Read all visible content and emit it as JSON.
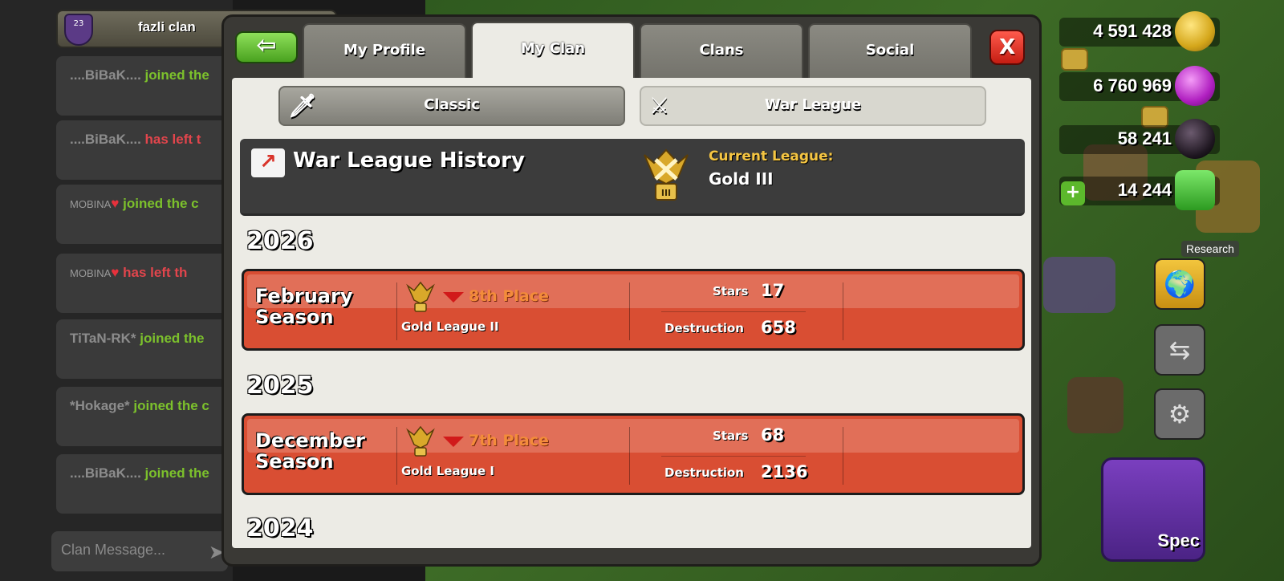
{
  "chat": {
    "clan_name": "fazli clan",
    "clan_level": "23",
    "messages": [
      {
        "user": "....BiBaK....",
        "action": "joined the",
        "type": "join"
      },
      {
        "user": "....BiBaK....",
        "action": "has left t",
        "type": "left"
      },
      {
        "user": "MOBINA",
        "heart": "♥",
        "action": "joined the c",
        "type": "join"
      },
      {
        "user": "MOBINA",
        "heart": "♥",
        "action": "has left th",
        "type": "left"
      },
      {
        "user": "TiTaN-RK*",
        "action": "joined the",
        "type": "join"
      },
      {
        "user": "*Hokage*",
        "action": "joined the c",
        "type": "join"
      },
      {
        "user": "....BiBaK....",
        "action": "joined the",
        "type": "join"
      }
    ],
    "input_placeholder": "Clan Message..."
  },
  "hud": {
    "gold": "4 591 428",
    "elixir": "6 760 969",
    "dark_elixir": "58 241",
    "gems": "14 244",
    "research_label": "Research",
    "special_label": "Spec"
  },
  "modal": {
    "tabs": [
      "My Profile",
      "My Clan",
      "Clans",
      "Social"
    ],
    "active_tab": "My Clan",
    "close_label": "X",
    "subtabs": [
      "Classic",
      "War League"
    ],
    "active_subtab": "War League",
    "history_title": "War League History",
    "current_league_label": "Current League:",
    "current_league_value": "Gold III",
    "current_league_badge": "III",
    "years": [
      {
        "year": "2026",
        "seasons": [
          {
            "name_line1": "February",
            "name_line2": "Season",
            "place": "8th Place",
            "league": "Gold League II",
            "stars_label": "Stars",
            "stars": "17",
            "destruction_label": "Destruction",
            "destruction": "658"
          }
        ]
      },
      {
        "year": "2025",
        "seasons": [
          {
            "name_line1": "December",
            "name_line2": "Season",
            "place": "7th Place",
            "league": "Gold League I",
            "stars_label": "Stars",
            "stars": "68",
            "destruction_label": "Destruction",
            "destruction": "2136"
          }
        ]
      },
      {
        "year": "2024",
        "seasons": []
      }
    ]
  },
  "colors": {
    "season_card": "#d94e33",
    "place_text": "#f38c3a",
    "current_league_label": "#f5c542",
    "join_text": "#7cc12c",
    "left_text": "#e2454c"
  }
}
